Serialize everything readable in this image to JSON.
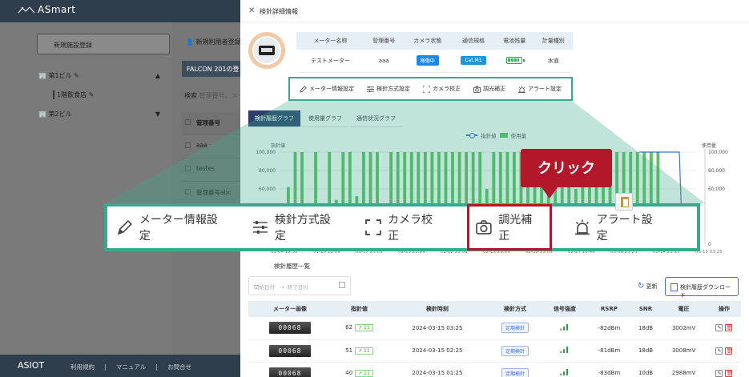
{
  "app": {
    "brand": "ASmart",
    "footer_brand": "ASIOT",
    "footer_links": [
      "利用規約",
      "マニュアル",
      "お問合せ"
    ]
  },
  "background": {
    "new_facility": "新規施設登録",
    "new_user": "新規利用者登録",
    "tree": [
      {
        "label": "第1ビル",
        "arrow": "▲"
      },
      {
        "label": "1階飲食店",
        "arrow": ""
      },
      {
        "label": "第2ビル",
        "arrow": "▼"
      }
    ],
    "active_tab": "FALCON 201の登",
    "filter_label": "検索",
    "filter_placeholder": "管理番号、メー",
    "table_header": "管理番号",
    "table_rows": [
      "aaa",
      "testes",
      "管理番号abc"
    ]
  },
  "drawer": {
    "title": "検針詳細情報",
    "info_headers": [
      "メーター名称",
      "管理番号",
      "カメラ状態",
      "通信規格",
      "電池残量",
      "計量種別"
    ],
    "info_values": {
      "name": "テストメーター",
      "id": "aaa",
      "camera": "稼働中",
      "comm": "Cat.M1",
      "type": "水道"
    },
    "actions": [
      "メーター情報設定",
      "検針方式設定",
      "カメラ校正",
      "調光補正",
      "アラート設定"
    ],
    "tabs": [
      "検針履歴グラフ",
      "使用量グラフ",
      "通信状況グラフ"
    ],
    "history_title": "検針履歴一覧",
    "date_from_placeholder": "開始日付",
    "date_to_placeholder": "終了日付",
    "date_arrow": "→",
    "refresh_label": "更新",
    "download_label": "検針履歴ダウンロード",
    "history_headers": [
      "メーター画像",
      "指針値",
      "検針時刻",
      "検針方式",
      "信号強度",
      "RSRP",
      "SNR",
      "電圧",
      "操作"
    ],
    "history_rows": [
      {
        "img": "00068",
        "value": "62",
        "diff": "11",
        "time": "2024-03-15 03:25",
        "method": "定期検針",
        "rsrp": "-82dBm",
        "snr": "18dB",
        "volt": "3002mV"
      },
      {
        "img": "00068",
        "value": "51",
        "diff": "11",
        "time": "2024-03-15 02:25",
        "method": "定期検針",
        "rsrp": "-81dBm",
        "snr": "18dB",
        "volt": "3008mV"
      },
      {
        "img": "00068",
        "value": "40",
        "diff": "11",
        "time": "2024-03-15 01:25",
        "method": "定期検針",
        "rsrp": "-83dBm",
        "snr": "10dB",
        "volt": "2988mV"
      }
    ]
  },
  "overlay": {
    "callout": "クリック",
    "highlighted_action": "調光補正"
  },
  "colors": {
    "accent_teal": "#3aa88c",
    "highlight_red": "#b3172a",
    "bar_green": "#5cc15e",
    "line_blue": "#3f6fcf"
  },
  "chart_data": {
    "type": "bar",
    "legend": [
      "指針値",
      "使用量"
    ],
    "ylabel_left": "指針値",
    "ylabel_right": "使用量",
    "yticks_left": [
      "100,000",
      "80,000",
      "60,000"
    ],
    "yticks_right": [
      "100,000",
      "80,000",
      "60,000",
      "0"
    ],
    "xticks": [
      "01-04 15:32",
      "01-10 23:09",
      "01-17 23:09",
      "01-25 23:09",
      "02-02 23:09",
      "02-11 23:09",
      "02-19 23:09",
      "02-27 16:46",
      "03-06 23:25",
      "03-14 23:25",
      "03-15 03:25"
    ],
    "series": [
      {
        "name": "使用量",
        "values": [
          62,
          100,
          100,
          44,
          100,
          36,
          100,
          48,
          100,
          100,
          52,
          100,
          100,
          100,
          40,
          100,
          100,
          100,
          100,
          100,
          100,
          100,
          100,
          100,
          100,
          100,
          100,
          100,
          100,
          60,
          100,
          100,
          100,
          100,
          100,
          100,
          100,
          100,
          100,
          100,
          100,
          100,
          60,
          100,
          100,
          100,
          100,
          100,
          100,
          100,
          100,
          100,
          100,
          100,
          100
        ]
      }
    ]
  }
}
